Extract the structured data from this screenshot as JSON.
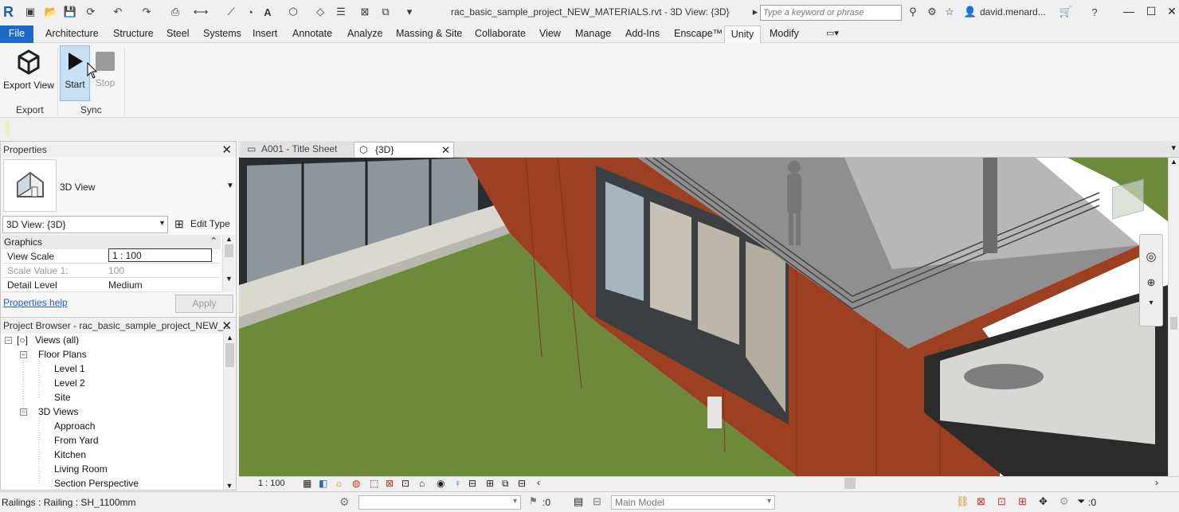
{
  "app": {
    "logo_letter": "R",
    "title": "rac_basic_sample_project_NEW_MATERIALS.rvt - 3D View: {3D}"
  },
  "search": {
    "placeholder": "Type a keyword or phrase"
  },
  "user": {
    "name": "david.menard..."
  },
  "ribbon": {
    "tabs": [
      "File",
      "Architecture",
      "Structure",
      "Steel",
      "Systems",
      "Insert",
      "Annotate",
      "Analyze",
      "Massing & Site",
      "Collaborate",
      "View",
      "Manage",
      "Add-Ins",
      "Enscape™",
      "Unity",
      "Modify"
    ],
    "active_tab": "Unity",
    "buttons": {
      "export_view": "Export View",
      "start": "Start",
      "stop": "Stop"
    },
    "panels": {
      "export": "Export",
      "sync": "Sync"
    }
  },
  "properties": {
    "title": "Properties",
    "type_name": "3D View",
    "view_selector": "3D View: {3D}",
    "edit_type": "Edit Type",
    "section": "Graphics",
    "rows": [
      {
        "key": "View Scale",
        "value": "1 : 100"
      },
      {
        "key": "Scale Value    1:",
        "value": "100"
      },
      {
        "key": "Detail Level",
        "value": "Medium"
      }
    ],
    "help_link": "Properties help",
    "apply": "Apply"
  },
  "browser": {
    "title": "Project Browser - rac_basic_sample_project_NEW_...",
    "tree": {
      "root": "Views (all)",
      "floor_plans": "Floor Plans",
      "floor_plan_items": [
        "Level 1",
        "Level 2",
        "Site"
      ],
      "views_3d": "3D Views",
      "views_3d_items": [
        "Approach",
        "From Yard",
        "Kitchen",
        "Living Room",
        "Section Perspective"
      ]
    }
  },
  "doc_tabs": [
    {
      "label": "A001 - Title Sheet",
      "active": false
    },
    {
      "label": "{3D}",
      "active": true
    }
  ],
  "viewbar": {
    "scale": "1 : 100"
  },
  "status": {
    "selection": "Railings : Railing : SH_1100mm",
    "workset_count": ":0",
    "model": "Main Model",
    "filter_count": ":0"
  },
  "colors": {
    "accent": "#1b6ac9",
    "cladding": "#9c3f22",
    "lawn": "#6d8a3a"
  }
}
